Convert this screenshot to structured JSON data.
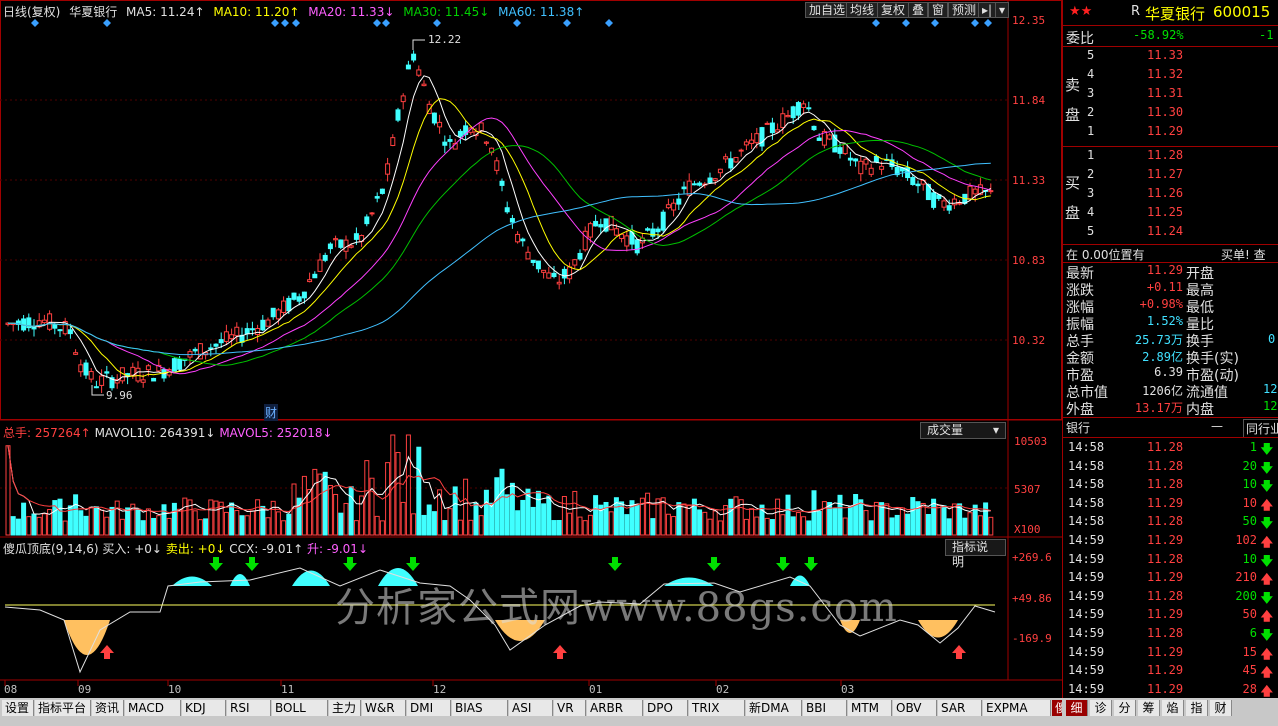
{
  "header": {
    "period": "日线(复权)",
    "stock_name": "华夏银行",
    "ma5": "MA5: 11.24↑",
    "ma10": "MA10: 11.20↑",
    "ma20": "MA20: 11.33↓",
    "ma30": "MA30: 11.45↓",
    "ma60": "MA60: 11.38↑"
  },
  "toolbar": {
    "add_watch": "加自选",
    "ma_lines": "均线",
    "restore_rights": "复权",
    "overlay": "叠",
    "window": "窗",
    "forecast": "预测",
    "arrow_btn": "▸|",
    "dropdown": "▾"
  },
  "price_axis": [
    "12.35",
    "11.84",
    "11.33",
    "10.83",
    "10.32"
  ],
  "annotations": {
    "high": "12.22",
    "low": "9.96",
    "finance": "财"
  },
  "volume": {
    "label_total": "总手: 257264↑",
    "label_mavol10": "MAVOL10: 264391↓",
    "label_mavol5": "MAVOL5: 252018↓",
    "button": "成交量",
    "axis": [
      "10503",
      "5307"
    ],
    "multiplier": "X100"
  },
  "indicator": {
    "label_name": "傻瓜顶底(9,14,6)",
    "label_buy": "买入: +0↓",
    "label_sell": "卖出: +0↓",
    "label_ccx": "CCX: -9.01↑",
    "label_rise": "升: -9.01↓",
    "button": "指标说明",
    "axis": [
      "+269.6",
      "+49.86",
      "-169.9"
    ]
  },
  "watermark": "分析家公式网www.88gs.com",
  "x_axis": [
    "08",
    "09",
    "10",
    "11",
    "12",
    "01",
    "02",
    "03"
  ],
  "bottom_tabs": [
    "设置",
    "指标平台",
    "资讯",
    "MACD",
    "KDJ",
    "RSI",
    "BOLL",
    "主力",
    "W&R",
    "DMI",
    "BIAS",
    "ASI",
    "VR",
    "ARBR",
    "DPO",
    "TRIX",
    "新DMA",
    "BBI",
    "MTM",
    "OBV",
    "SAR",
    "EXPMA",
    "傻瓜顶底"
  ],
  "right_panel": {
    "prefix": "R",
    "stock_name": "华夏银行",
    "stock_code": "600015",
    "ratio_label": "委比",
    "ratio_value": "-58.92%",
    "ratio_extra": "-1",
    "sell_label": "卖盘",
    "buy_label": "买盘",
    "sell_orders": [
      {
        "level": "5",
        "price": "11.33"
      },
      {
        "level": "4",
        "price": "11.32"
      },
      {
        "level": "3",
        "price": "11.31"
      },
      {
        "level": "2",
        "price": "11.30"
      },
      {
        "level": "1",
        "price": "11.29"
      }
    ],
    "buy_orders": [
      {
        "level": "1",
        "price": "11.28"
      },
      {
        "level": "2",
        "price": "11.27"
      },
      {
        "level": "3",
        "price": "11.26"
      },
      {
        "level": "4",
        "price": "11.25"
      },
      {
        "level": "5",
        "price": "11.24"
      }
    ],
    "position_label": "在 0.00位置有",
    "buy_single": "买单! 查",
    "stats": [
      {
        "k1": "最新",
        "v1": "11.29",
        "c1": "red",
        "k2": "开盘"
      },
      {
        "k1": "涨跌",
        "v1": "+0.11",
        "c1": "red",
        "k2": "最高"
      },
      {
        "k1": "涨幅",
        "v1": "+0.98%",
        "c1": "red",
        "k2": "最低"
      },
      {
        "k1": "振幅",
        "v1": "1.52%",
        "c1": "cyan",
        "k2": "量比"
      },
      {
        "k1": "总手",
        "v1": "25.73万",
        "c1": "cyan",
        "k2": "换手"
      },
      {
        "k1": "金额",
        "v1": "2.89亿",
        "c1": "cyan",
        "k2": "换手(实)"
      },
      {
        "k1": "市盈",
        "v1": "6.39",
        "c1": "white",
        "k2": "市盈(动)"
      },
      {
        "k1": "总市值",
        "v1": "1206亿",
        "c1": "white",
        "k2": "流通值"
      },
      {
        "k1": "外盘",
        "v1": "13.17万",
        "c1": "red",
        "k2": "内盘"
      }
    ],
    "stats_extra": {
      "huanshou": "0",
      "liutong": "12",
      "neipan": "12"
    },
    "sector": "银行",
    "sector_dropdown": "—",
    "sector_btn": "同行业",
    "ticks": [
      {
        "time": "14:58",
        "price": "11.28",
        "pc": "red",
        "vol": "1",
        "dir": "down"
      },
      {
        "time": "14:58",
        "price": "11.28",
        "pc": "red",
        "vol": "20",
        "dir": "down"
      },
      {
        "time": "14:58",
        "price": "11.28",
        "pc": "red",
        "vol": "10",
        "dir": "down"
      },
      {
        "time": "14:58",
        "price": "11.29",
        "pc": "red",
        "vol": "10",
        "dir": "up"
      },
      {
        "time": "14:58",
        "price": "11.28",
        "pc": "red",
        "vol": "50",
        "dir": "down"
      },
      {
        "time": "14:59",
        "price": "11.29",
        "pc": "red",
        "vol": "102",
        "dir": "up"
      },
      {
        "time": "14:59",
        "price": "11.28",
        "pc": "red",
        "vol": "10",
        "dir": "down"
      },
      {
        "time": "14:59",
        "price": "11.29",
        "pc": "red",
        "vol": "210",
        "dir": "up"
      },
      {
        "time": "14:59",
        "price": "11.28",
        "pc": "red",
        "vol": "200",
        "dir": "down"
      },
      {
        "time": "14:59",
        "price": "11.29",
        "pc": "red",
        "vol": "50",
        "dir": "up"
      },
      {
        "time": "14:59",
        "price": "11.28",
        "pc": "red",
        "vol": "6",
        "dir": "down"
      },
      {
        "time": "14:59",
        "price": "11.29",
        "pc": "red",
        "vol": "15",
        "dir": "up"
      },
      {
        "time": "14:59",
        "price": "11.29",
        "pc": "red",
        "vol": "45",
        "dir": "up"
      },
      {
        "time": "14:59",
        "price": "11.29",
        "pc": "red",
        "vol": "28",
        "dir": "up"
      }
    ],
    "tabs": [
      "细",
      "诊",
      "分",
      "筹",
      "焰",
      "指",
      "财"
    ]
  },
  "colors": {
    "up": "#ff4040",
    "down": "#40ffff",
    "ma5": "#ffffff",
    "ma10": "#ffff00",
    "ma20": "#ff40ff",
    "ma30": "#00c000",
    "ma60": "#40c0ff",
    "grid": "#a00000"
  }
}
